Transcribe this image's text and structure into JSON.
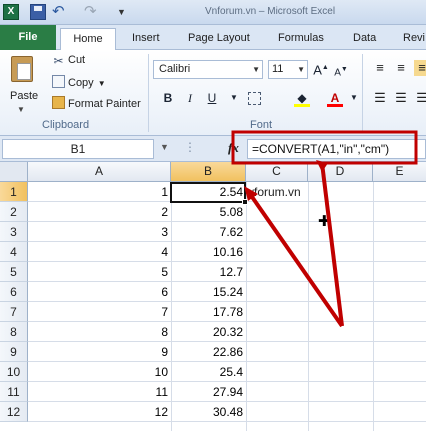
{
  "window": {
    "title": "Vnforum.vn – Microsoft Excel"
  },
  "tabs": [
    {
      "label": "File"
    },
    {
      "label": "Home"
    },
    {
      "label": "Insert"
    },
    {
      "label": "Page Layout"
    },
    {
      "label": "Formulas"
    },
    {
      "label": "Data"
    },
    {
      "label": "Revi"
    }
  ],
  "ribbon": {
    "clipboard": {
      "paste": "Paste",
      "cut": "Cut",
      "copy": "Copy",
      "format_painter": "Format Painter",
      "group_label": "Clipboard"
    },
    "font": {
      "name": "Calibri",
      "size": "11",
      "bold": "B",
      "italic": "I",
      "underline": "U",
      "font_color_letter": "A",
      "group_label": "Font",
      "fill_color": "#ffff00",
      "font_color": "#ff0000"
    }
  },
  "formula_bar": {
    "name_box": "B1",
    "fx": "fx",
    "formula": "=CONVERT(A1,\"in\",\"cm\")"
  },
  "grid": {
    "columns": [
      "A",
      "B",
      "C",
      "D",
      "E"
    ],
    "selected_column": "B",
    "selected_row": "1",
    "rows": [
      {
        "row": "1",
        "a": "1",
        "b": "2.54"
      },
      {
        "row": "2",
        "a": "2",
        "b": "5.08"
      },
      {
        "row": "3",
        "a": "3",
        "b": "7.62"
      },
      {
        "row": "4",
        "a": "4",
        "b": "10.16"
      },
      {
        "row": "5",
        "a": "5",
        "b": "12.7"
      },
      {
        "row": "6",
        "a": "6",
        "b": "15.24"
      },
      {
        "row": "7",
        "a": "7",
        "b": "17.78"
      },
      {
        "row": "8",
        "a": "8",
        "b": "20.32"
      },
      {
        "row": "9",
        "a": "9",
        "b": "22.86"
      },
      {
        "row": "10",
        "a": "10",
        "b": "25.4"
      },
      {
        "row": "11",
        "a": "11",
        "b": "27.94"
      },
      {
        "row": "12",
        "a": "12",
        "b": "30.48"
      }
    ],
    "c1_text": "vforum.vn"
  },
  "annotation_color": "#c00000"
}
